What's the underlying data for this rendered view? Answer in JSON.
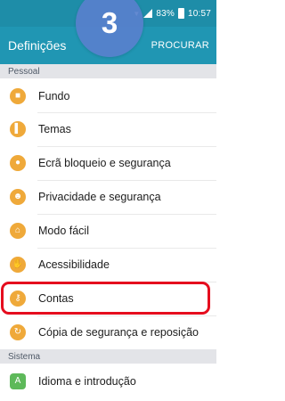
{
  "status_bar": {
    "battery": "83%",
    "time": "10:57",
    "icons": [
      "wifi-icon",
      "signal-icon",
      "battery-icon"
    ]
  },
  "app_bar": {
    "title": "Definições",
    "search_action": "PROCURAR"
  },
  "step_badge": "3",
  "sections": {
    "pessoal": "Pessoal",
    "sistema": "Sistema"
  },
  "items": [
    {
      "label": "Fundo",
      "icon": "image-icon"
    },
    {
      "label": "Temas",
      "icon": "brush-icon"
    },
    {
      "label": "Ecrã bloqueio e segurança",
      "icon": "lock-icon"
    },
    {
      "label": "Privacidade e segurança",
      "icon": "person-icon"
    },
    {
      "label": "Modo fácil",
      "icon": "home-icon"
    },
    {
      "label": "Acessibilidade",
      "icon": "hand-icon"
    },
    {
      "label": "Contas",
      "icon": "key-icon"
    },
    {
      "label": "Cópia de segurança e reposição",
      "icon": "backup-icon"
    },
    {
      "label": "Idioma e introdução",
      "icon": "language-icon"
    }
  ],
  "colors": {
    "status_bar": "#1e8da8",
    "app_bar": "#2096b3",
    "icon_orange": "#efa93a",
    "icon_green": "#5eb95a",
    "highlight": "#e50d1e"
  }
}
